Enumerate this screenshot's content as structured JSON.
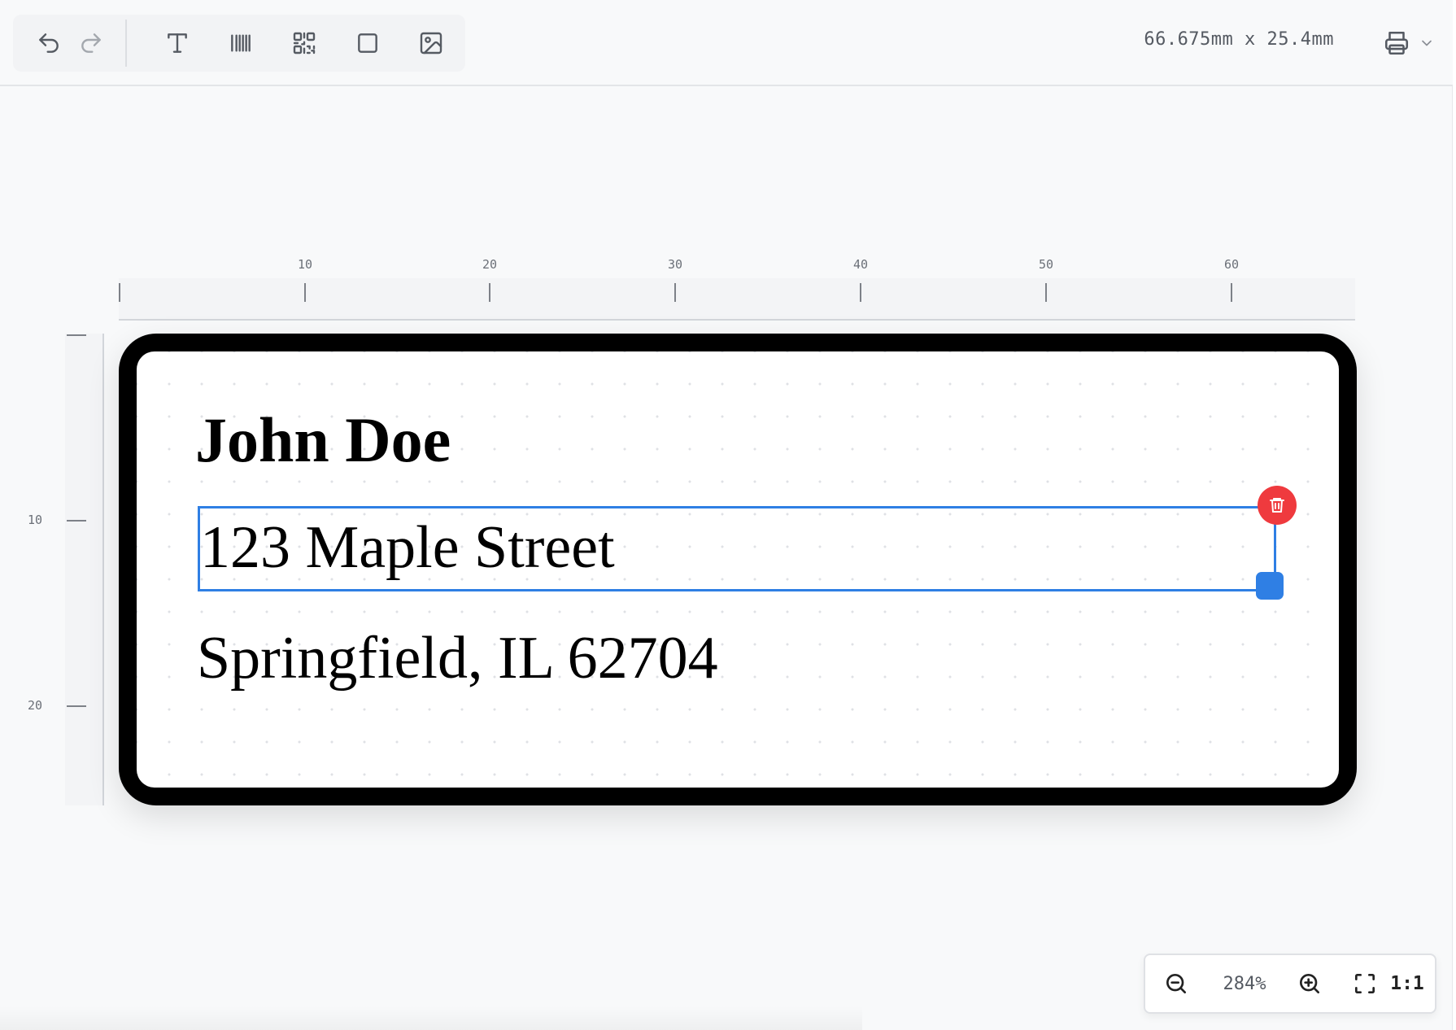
{
  "toolbar": {
    "tools": [
      {
        "name": "undo-icon",
        "tooltip": "Undo"
      },
      {
        "name": "redo-icon",
        "tooltip": "Redo"
      },
      {
        "name": "text-tool-icon",
        "tooltip": "Text"
      },
      {
        "name": "barcode-tool-icon",
        "tooltip": "Barcode"
      },
      {
        "name": "qrcode-tool-icon",
        "tooltip": "QR Code"
      },
      {
        "name": "rectangle-tool-icon",
        "tooltip": "Rectangle"
      },
      {
        "name": "image-tool-icon",
        "tooltip": "Image"
      }
    ],
    "label_size": "66.675mm x 25.4mm",
    "print_icon": "printer-icon",
    "print_menu_icon": "chevron-down-icon"
  },
  "ruler": {
    "horizontal_labels": [
      "10",
      "20",
      "30",
      "40",
      "50",
      "60"
    ],
    "vertical_labels": [
      "10",
      "20"
    ]
  },
  "label": {
    "lines": [
      {
        "text": "John Doe",
        "weight": "bold"
      },
      {
        "text": "123 Maple Street",
        "weight": "normal",
        "selected": true
      },
      {
        "text": "Springfield, IL 62704",
        "weight": "normal"
      }
    ],
    "delete_icon": "trash-icon"
  },
  "zoom": {
    "level": "284%",
    "reset_label": "1:1",
    "zoom_out_icon": "zoom-out-icon",
    "zoom_in_icon": "zoom-in-icon",
    "fit_icon": "fit-screen-icon"
  },
  "colors": {
    "selection": "#2f7fe4",
    "delete": "#ef3a3e",
    "label_border": "#000000",
    "canvas_bg": "#f8f9fa"
  }
}
